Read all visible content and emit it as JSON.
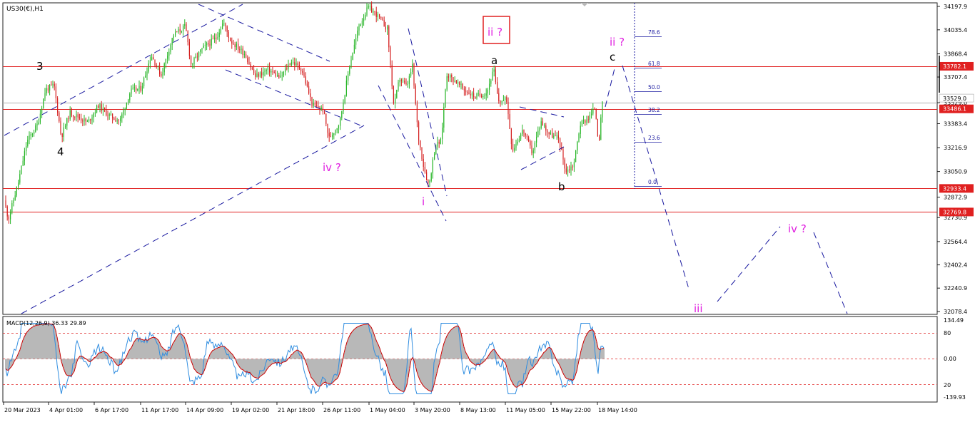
{
  "header": {
    "symbol_label": "US30(€),H1"
  },
  "chart_data": {
    "type": "candlestick",
    "price_axis": {
      "ticks": [
        "34197.9",
        "34035.4",
        "33868.4",
        "33707.4",
        "33529.0",
        "33383.4",
        "33216.9",
        "33050.9",
        "32872.9",
        "32730.9",
        "32564.4",
        "32402.4",
        "32240.9",
        "32078.4"
      ],
      "range": [
        32045,
        34220
      ]
    },
    "horizontal_levels": [
      {
        "value": 33782.1,
        "label": "33782.1",
        "color": "#e02020"
      },
      {
        "value": 33486.1,
        "label": "33486.1",
        "color": "#e02020"
      },
      {
        "value": 32933.4,
        "label": "32933.4",
        "color": "#e02020"
      },
      {
        "value": 32769.8,
        "label": "32769.8",
        "color": "#e02020"
      }
    ],
    "current_price": {
      "value": 33529.0,
      "label": "33529.0"
    },
    "fibonacci": {
      "levels": [
        "78.6",
        "61.8",
        "50.0",
        "38.2",
        "23.6",
        "0.0"
      ],
      "color": "#1a1aa0"
    },
    "wave_labels": {
      "black": [
        "3",
        "4",
        "a",
        "b",
        "c"
      ],
      "magenta": [
        "iv ?",
        "i",
        "ii ?",
        "iii",
        "iv ?"
      ],
      "boxed": "ii ?"
    },
    "time_axis": [
      "20 Mar 2023",
      "4 Apr 01:00",
      "6 Apr 17:00",
      "11 Apr 17:00",
      "14 Apr 09:00",
      "19 Apr 02:00",
      "21 Apr 18:00",
      "26 Apr 11:00",
      "1 May 04:00",
      "3 May 20:00",
      "8 May 13:00",
      "11 May 05:00",
      "15 May 22:00",
      "18 May 14:00"
    ],
    "macd": {
      "label": "MACD(12,26,9) 36.33 29.89",
      "ticks": [
        "134.49",
        "80",
        "0.00",
        "20",
        "-139.93"
      ],
      "main": 36.33,
      "signal": 29.89
    },
    "colors": {
      "bull": "#26b526",
      "bear": "#d42020",
      "macd_line": "#2f8de0",
      "signal_line": "#cc0000",
      "histogram": "#b8b8b8",
      "pattern": "#1a1aa0",
      "magenta": "#e020e0"
    }
  }
}
